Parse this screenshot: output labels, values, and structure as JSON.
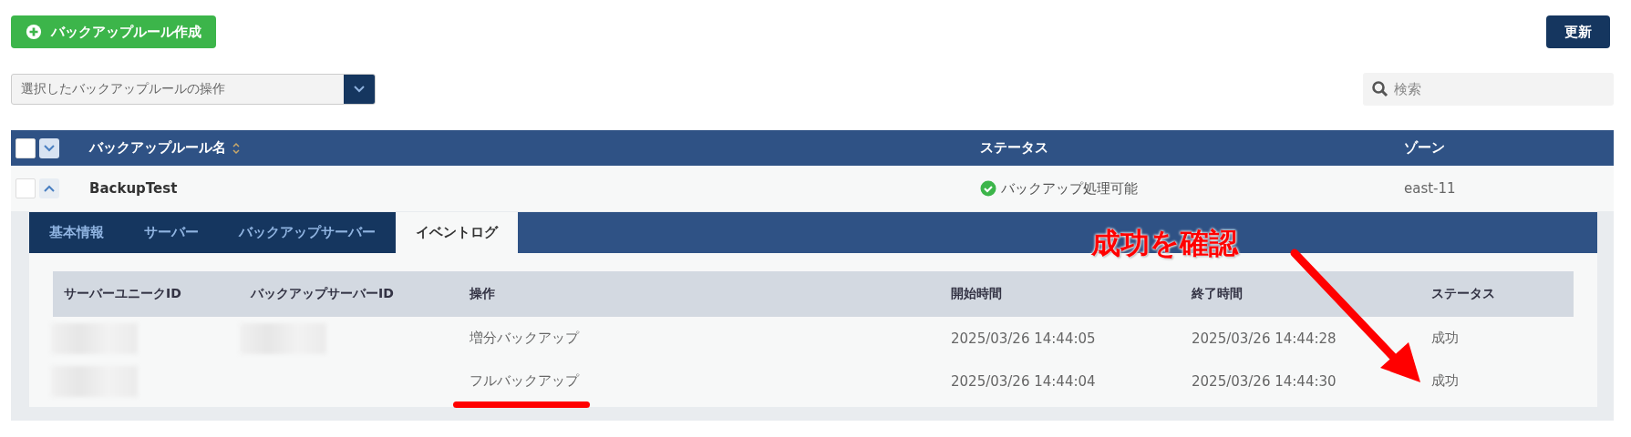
{
  "toolbar": {
    "create_button": "バックアップルール作成",
    "refresh_button": "更新"
  },
  "bulk_action": {
    "value": "選択したバックアップルールの操作"
  },
  "search": {
    "placeholder": "検索"
  },
  "table": {
    "columns": [
      "バックアップルール名",
      "ステータス",
      "ゾーン"
    ],
    "header_checked": false,
    "rows": [
      {
        "name": "BackupTest",
        "status": "バックアップ処理可能",
        "zone": "east-11",
        "checked": false,
        "expanded": true
      }
    ]
  },
  "detail": {
    "tabs": [
      {
        "label": "基本情報",
        "selected": false
      },
      {
        "label": "サーバー",
        "selected": false
      },
      {
        "label": "バックアップサーバー",
        "selected": false
      },
      {
        "label": "イベントログ",
        "selected": true
      }
    ],
    "event_log": {
      "columns": [
        "サーバーユニークID",
        "バックアップサーバーID",
        "操作",
        "開始時間",
        "終了時間",
        "ステータス"
      ],
      "rows": [
        {
          "server_id_redacted": true,
          "backup_server_id_redacted": true,
          "operation": "増分バックアップ",
          "start": "2025/03/26 14:44:05",
          "end": "2025/03/26 14:44:28",
          "status": "成功",
          "underlined": false
        },
        {
          "server_id_redacted": true,
          "backup_server_id_redacted": false,
          "operation": "フルバックアップ",
          "start": "2025/03/26 14:44:04",
          "end": "2025/03/26 14:44:30",
          "status": "成功",
          "underlined": true
        }
      ]
    }
  },
  "annotation": {
    "text": "成功を確認"
  }
}
